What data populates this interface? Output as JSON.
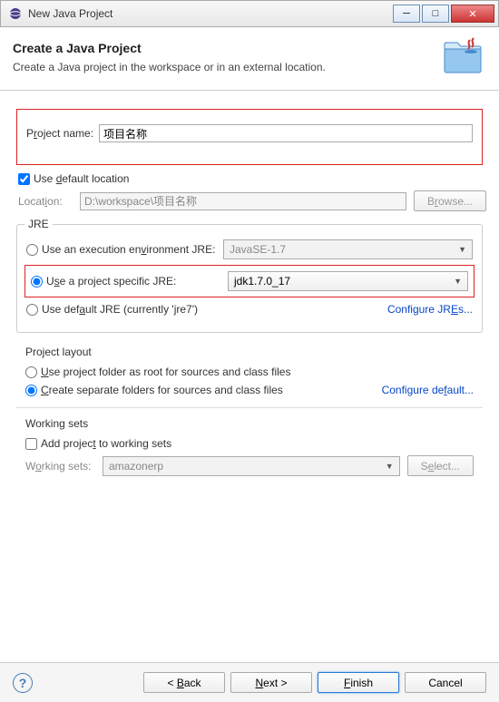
{
  "window": {
    "title": "New Java Project"
  },
  "header": {
    "title": "Create a Java Project",
    "desc": "Create a Java project in the workspace or in an external location."
  },
  "project": {
    "name_label_pre": "P",
    "name_label_u": "r",
    "name_label_post": "oject name:",
    "name_value": "项目名称",
    "use_default_pre": "Use ",
    "use_default_u": "d",
    "use_default_post": "efault location",
    "location_label_pre": "Locat",
    "location_label_u": "i",
    "location_label_post": "on:",
    "location_value": "D:\\workspace\\项目名称",
    "browse_pre": "B",
    "browse_u": "r",
    "browse_post": "owse..."
  },
  "jre": {
    "legend": "JRE",
    "opt1_pre": "Use an execution en",
    "opt1_u": "v",
    "opt1_post": "ironment JRE:",
    "opt1_value": "JavaSE-1.7",
    "opt2_pre": "U",
    "opt2_u": "s",
    "opt2_post": "e a project specific JRE:",
    "opt2_value": "jdk1.7.0_17",
    "opt3_pre": "Use def",
    "opt3_u": "a",
    "opt3_post": "ult JRE (currently 'jre7')",
    "config_pre": "Configure JR",
    "config_u": "E",
    "config_post": "s..."
  },
  "layout": {
    "legend": "Project layout",
    "opt1": "Use project folder as root for sources and class files",
    "opt1_u": "U",
    "opt1_post": "se project folder as root for sources and class files",
    "opt2_u": "C",
    "opt2_post": "reate separate folders for sources and class files",
    "config_pre": "Configure de",
    "config_u": "f",
    "config_post": "ault..."
  },
  "ws": {
    "legend": "Working sets",
    "add_pre": "Add projec",
    "add_u": "t",
    "add_post": " to working sets",
    "label_pre": "W",
    "label_u": "o",
    "label_post": "rking sets:",
    "value": "amazonerp",
    "select_pre": "S",
    "select_u": "e",
    "select_post": "lect..."
  },
  "footer": {
    "back_pre": "< ",
    "back_u": "B",
    "back_post": "ack",
    "next_u": "N",
    "next_post": "ext >",
    "finish_u": "F",
    "finish_post": "inish",
    "cancel": "Cancel"
  }
}
